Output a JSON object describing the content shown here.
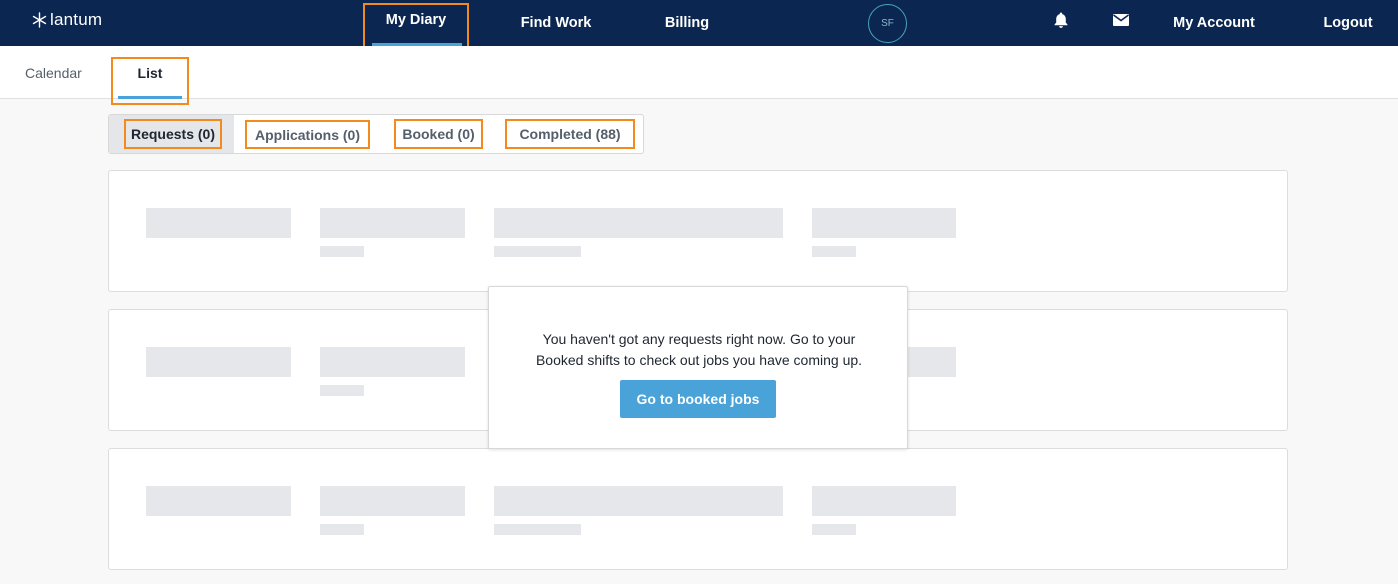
{
  "brand": {
    "name": "lantum"
  },
  "topnav": {
    "my_diary": "My Diary",
    "find_work": "Find Work",
    "billing": "Billing",
    "avatar_initials": "SF",
    "my_account": "My Account",
    "logout": "Logout",
    "icons": [
      "bell-icon",
      "mail-icon"
    ]
  },
  "subnav": {
    "calendar": "Calendar",
    "list": "List"
  },
  "tabs": [
    {
      "label": "Requests (0)",
      "active": true
    },
    {
      "label": "Applications (0)",
      "active": false
    },
    {
      "label": "Booked (0)",
      "active": false
    },
    {
      "label": "Completed (88)",
      "active": false
    }
  ],
  "empty_state": {
    "line1": "You haven't got any requests right now. Go to your",
    "line2": "Booked shifts to check out jobs you have coming up.",
    "button": "Go to booked jobs"
  },
  "colors": {
    "navbar": "#0b2651",
    "accent": "#4aa3d8",
    "highlight": "#f28a1c"
  }
}
